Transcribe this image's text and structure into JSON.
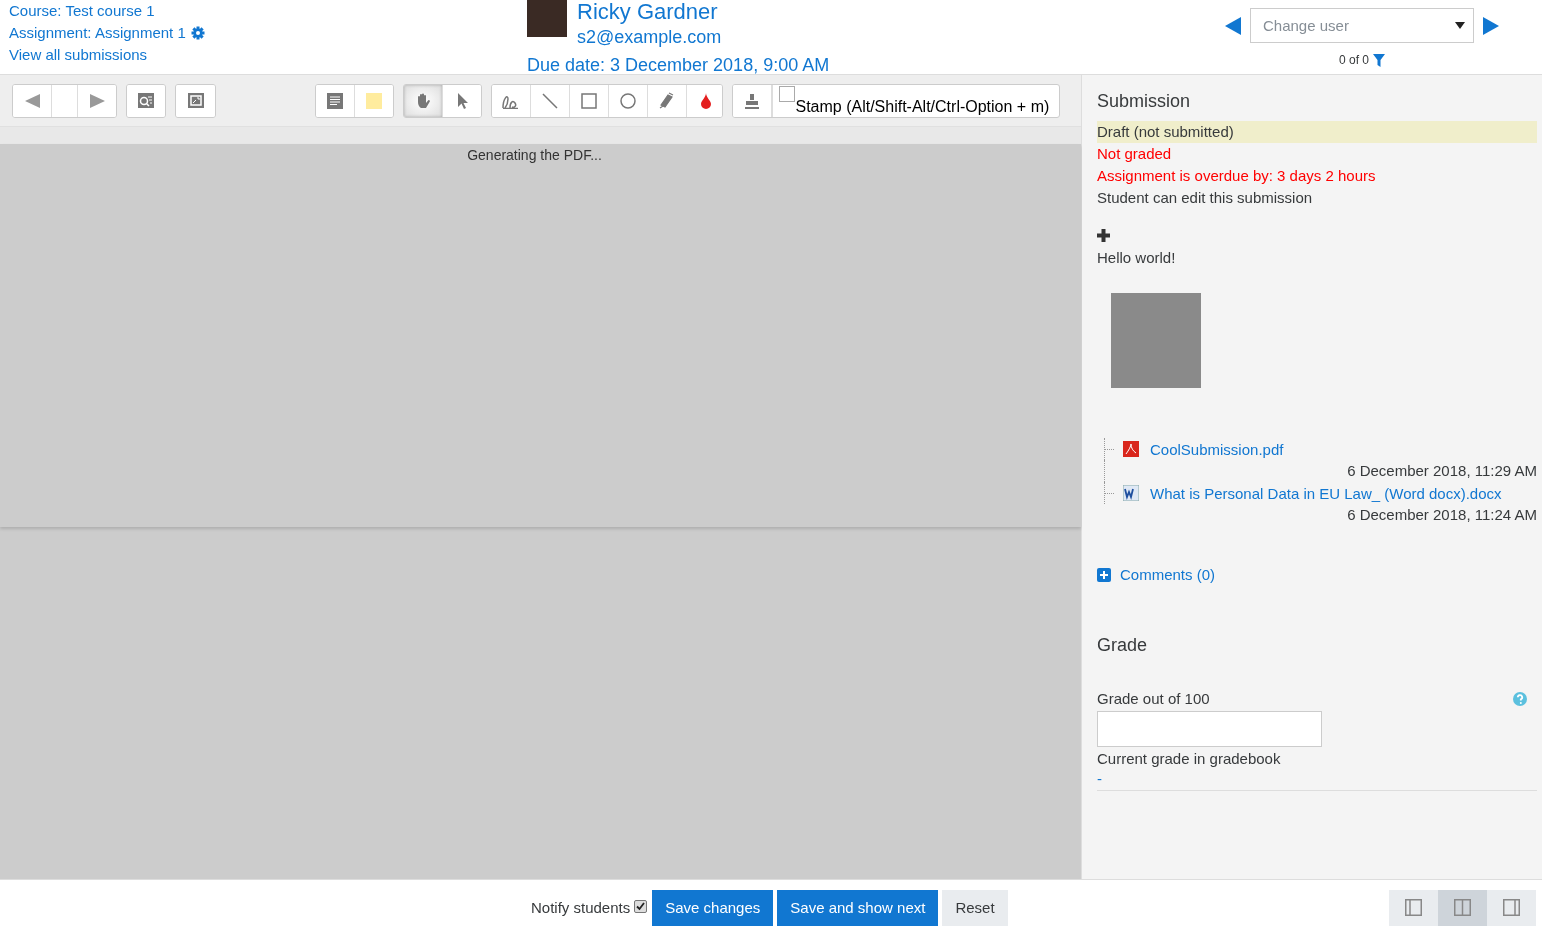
{
  "header": {
    "course_link": "Course: Test course 1",
    "assignment_link": "Assignment: Assignment 1",
    "view_all_link": "View all submissions",
    "user": {
      "name": "Ricky Gardner",
      "email": "s2@example.com",
      "due_date": "Due date: 3 December 2018, 9:00 AM"
    },
    "change_user": {
      "placeholder": "Change user",
      "count": "0 of 0"
    }
  },
  "toolbar": {
    "groups": [
      {
        "tools": [
          {
            "kind": "prev-page",
            "selected": false
          },
          {
            "kind": "page-select",
            "selected": false
          },
          {
            "kind": "next-page",
            "selected": false
          }
        ]
      },
      {
        "tools": [
          {
            "kind": "search-comments",
            "selected": false
          }
        ]
      },
      {
        "tools": [
          {
            "kind": "expand",
            "selected": false
          }
        ]
      },
      {
        "tools": [
          {
            "kind": "comment",
            "selected": false
          },
          {
            "kind": "comment-color",
            "selected": false
          }
        ]
      },
      {
        "tools": [
          {
            "kind": "pan",
            "selected": true
          },
          {
            "kind": "select",
            "selected": false
          }
        ]
      },
      {
        "tools": [
          {
            "kind": "pen",
            "selected": false
          },
          {
            "kind": "line",
            "selected": false
          },
          {
            "kind": "rectangle",
            "selected": false
          },
          {
            "kind": "oval",
            "selected": false
          },
          {
            "kind": "highlighter",
            "selected": false
          },
          {
            "kind": "color",
            "selected": false
          }
        ]
      },
      {
        "tools": [
          {
            "kind": "stamp",
            "selected": false
          }
        ]
      }
    ],
    "stamp": {
      "checked": false,
      "label": "Stamp (Alt/Shift-Alt/Ctrl-Option + m)"
    }
  },
  "pdf": {
    "status": "Generating the PDF..."
  },
  "submission": {
    "heading": "Submission",
    "statuses": [
      {
        "text": "Draft (not submitted)",
        "kind": "highlight"
      },
      {
        "text": "Not graded",
        "kind": "alert"
      },
      {
        "text": "Assignment is overdue by: 3 days 2 hours",
        "kind": "alert"
      },
      {
        "text": "Student can edit this submission",
        "kind": "normal"
      }
    ],
    "online_text": "Hello world!",
    "files": [
      {
        "name": "CoolSubmission.pdf",
        "date": "6 December 2018, 11:29 AM",
        "kind": "pdf"
      },
      {
        "name": "What is Personal Data in EU Law_ (Word docx).docx",
        "date": "6 December 2018, 11:24 AM",
        "kind": "word"
      }
    ],
    "comments_link": "Comments (0)"
  },
  "grade": {
    "heading": "Grade",
    "label": "Grade out of 100",
    "current_label": "Current grade in gradebook",
    "current_value": "-"
  },
  "footer": {
    "notify": {
      "label": "Notify students",
      "checked": true
    },
    "buttons": [
      {
        "label": "Save changes",
        "kind": "primary"
      },
      {
        "label": "Save and show next",
        "kind": "primary"
      },
      {
        "label": "Reset",
        "kind": "secondary"
      }
    ],
    "layouts": [
      {
        "kind": "collapse-review",
        "selected": false
      },
      {
        "kind": "default",
        "selected": true
      },
      {
        "kind": "collapse-grade",
        "selected": false
      }
    ]
  }
}
